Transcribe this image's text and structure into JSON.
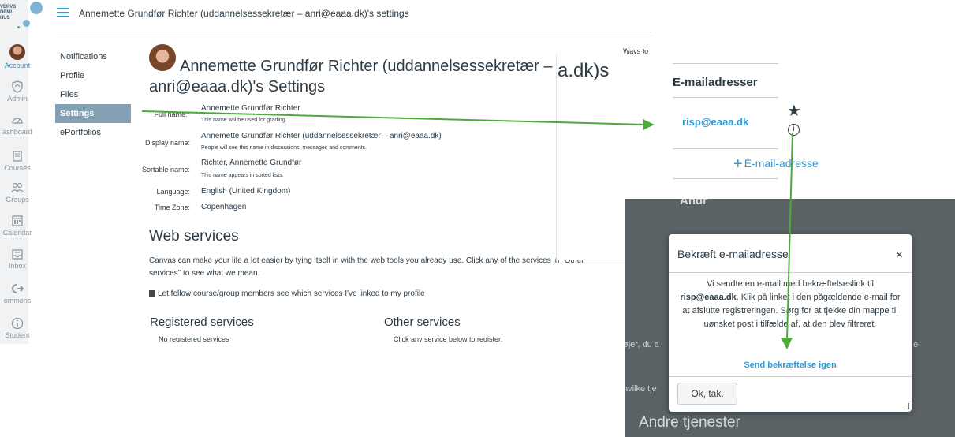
{
  "global_nav": {
    "logo_text": "VERVS\nDEMI\nHUS",
    "items": [
      {
        "label": "Account",
        "icon": "avatar"
      },
      {
        "label": "Admin",
        "icon": "shield-icon"
      },
      {
        "label": "ashboard",
        "icon": "dashboard-icon"
      },
      {
        "label": "Courses",
        "icon": "book-icon"
      },
      {
        "label": "Groups",
        "icon": "groups-icon"
      },
      {
        "label": "Calendar",
        "icon": "calendar-icon"
      },
      {
        "label": "Inbox",
        "icon": "inbox-icon"
      },
      {
        "label": "ommons",
        "icon": "commons-icon"
      },
      {
        "label": "Student",
        "icon": "info-icon"
      }
    ]
  },
  "header": {
    "breadcrumb": "Annemette Grundfør Richter (uddannelsessekretær – anri@eaaa.dk)'s settings"
  },
  "subnav": {
    "items": [
      "Notifications",
      "Profile",
      "Files",
      "Settings",
      "ePortfolios"
    ],
    "active_index": 3
  },
  "main": {
    "title_line1": "Annemette Grundfør Richter (uddannelsessekretær –",
    "title_line2": "anri@eaaa.dk)'s Settings",
    "fields": {
      "full_name_label": "Full name:*",
      "full_name_value": "Annemette Grundfør Richter",
      "full_name_hint": "This name will be used for grading.",
      "display_name_label": "Display name:",
      "display_name_value": "Annemette Grundfør Richter (uddannelsessekretær – anri@eaaa.dk)",
      "display_name_hint": "People will see this name in discussions, messages and comments.",
      "sortable_name_label": "Sortable name:",
      "sortable_name_value": "Richter, Annemette Grundfør",
      "sortable_name_hint": "This name appears in sorted lists.",
      "language_label": "Language:",
      "language_value": "English (United Kingdom)",
      "timezone_label": "Time Zone:",
      "timezone_value": "Copenhagen"
    },
    "web_services_title": "Web services",
    "web_services_text": "Canvas can make your life a lot easier by tying itself in with the web tools you already use. Click any of the services in \"Other services\" to see what we mean.",
    "checkbox_label": "Let fellow course/group members see which services I've linked to my profile",
    "registered_title": "Registered services",
    "registered_text": "No registered services",
    "other_title": "Other services",
    "other_text": "Click any service below to register:"
  },
  "overlay_email": {
    "ways_text": "Ways to",
    "big_text": "a.dk)s",
    "heading": "E-mailadresser",
    "email": "risp@eaaa.dk",
    "add_label": "E-mail-adresse"
  },
  "overlay_dialog": {
    "bg_heading": "Andr",
    "bg_text1": "øjer, du a",
    "bg_text2": "e",
    "bg_text3": "hvilke tje",
    "bg_bottom": "Andre tjenester",
    "title": "Bekræft e-mailadresse",
    "close": "×",
    "body_line1": "Vi sendte en e-mail med bekræftelseslink til",
    "body_email": "risp@eaaa.dk",
    "body_rest": ". Klik på linket i den pågældende e-mail for at afslutte registreringen. Sørg for at tjekke din mappe til uønsket post i tilfælde af, at den blev filtreret.",
    "resend": "Send bekræftelse igen",
    "ok": "Ok, tak."
  },
  "colors": {
    "link": "#2d9bd8",
    "arrow": "#4caa3a",
    "active_subnav": "#83a1b3"
  }
}
